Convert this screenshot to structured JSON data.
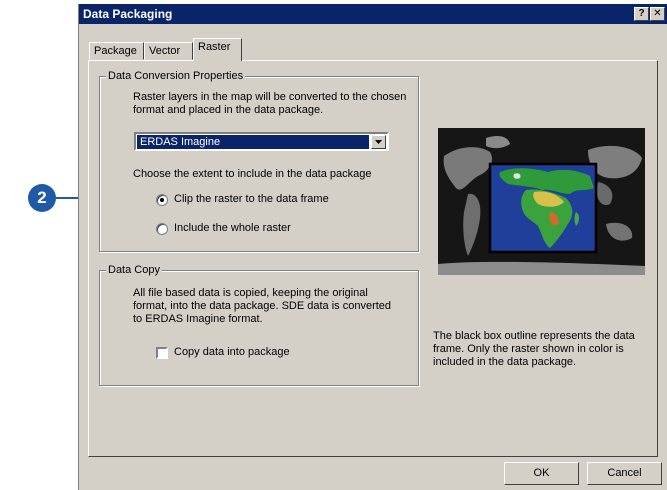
{
  "window": {
    "title": "Data Packaging",
    "help_label": "?",
    "close_label": "✕"
  },
  "tabs": [
    {
      "label": "Package"
    },
    {
      "label": "Vector"
    },
    {
      "label": "Raster"
    }
  ],
  "conversion": {
    "legend": "Data Conversion Properties",
    "description": "Raster layers in the map will be converted to the chosen format and placed in the data package.",
    "format_value": "ERDAS Imagine",
    "extent_prompt": "Choose the extent  to include in the data package",
    "option_clip": "Clip the raster to the data frame",
    "option_whole": "Include the whole raster",
    "selected_option": "clip"
  },
  "copy": {
    "legend": "Data Copy",
    "description": "All file based data is copied, keeping the original format, into the data package.   SDE data is converted to ERDAS Imagine format.",
    "checkbox_label": "Copy data into package",
    "checked": false
  },
  "preview": {
    "caption": "The black box outline represents the data frame.  Only the raster shown in color is included in the data package."
  },
  "buttons": {
    "ok": "OK",
    "cancel": "Cancel"
  },
  "callout": {
    "number": "2",
    "color": "#1e5aa6"
  },
  "colors": {
    "title_bar": "#0a246a",
    "dialog_face": "#d4d0c8"
  }
}
